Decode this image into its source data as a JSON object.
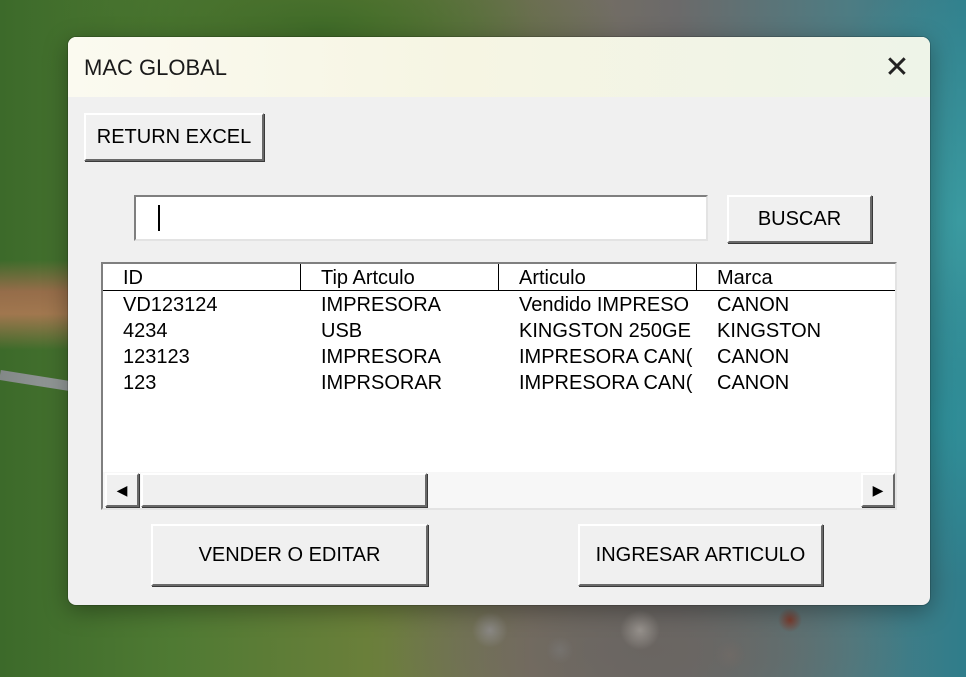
{
  "window": {
    "title": "MAC GLOBAL",
    "close_icon": "close-icon",
    "close_glyph": "✕"
  },
  "toolbar": {
    "return_label": "RETURN EXCEL"
  },
  "search": {
    "value": "",
    "button_label": "BUSCAR"
  },
  "list": {
    "columns": [
      "ID",
      "Tip Artculo",
      "Articulo",
      "Marca"
    ],
    "rows": [
      [
        "VD123124",
        "IMPRESORA",
        "Vendido IMPRESO",
        "CANON"
      ],
      [
        "4234",
        "USB",
        "KINGSTON 250GE",
        "KINGSTON"
      ],
      [
        "123123",
        "IMPRESORA",
        "IMPRESORA CAN(",
        "CANON"
      ],
      [
        "123",
        "IMPRSORAR",
        "IMPRESORA CAN(",
        "CANON"
      ]
    ],
    "scroll_left_icon": "arrow-left-icon",
    "scroll_right_icon": "arrow-right-icon",
    "scroll_left_glyph": "◀",
    "scroll_right_glyph": "▶"
  },
  "actions": {
    "vender_label": "VENDER O EDITAR",
    "ingresar_label": "INGRESAR ARTICULO"
  }
}
